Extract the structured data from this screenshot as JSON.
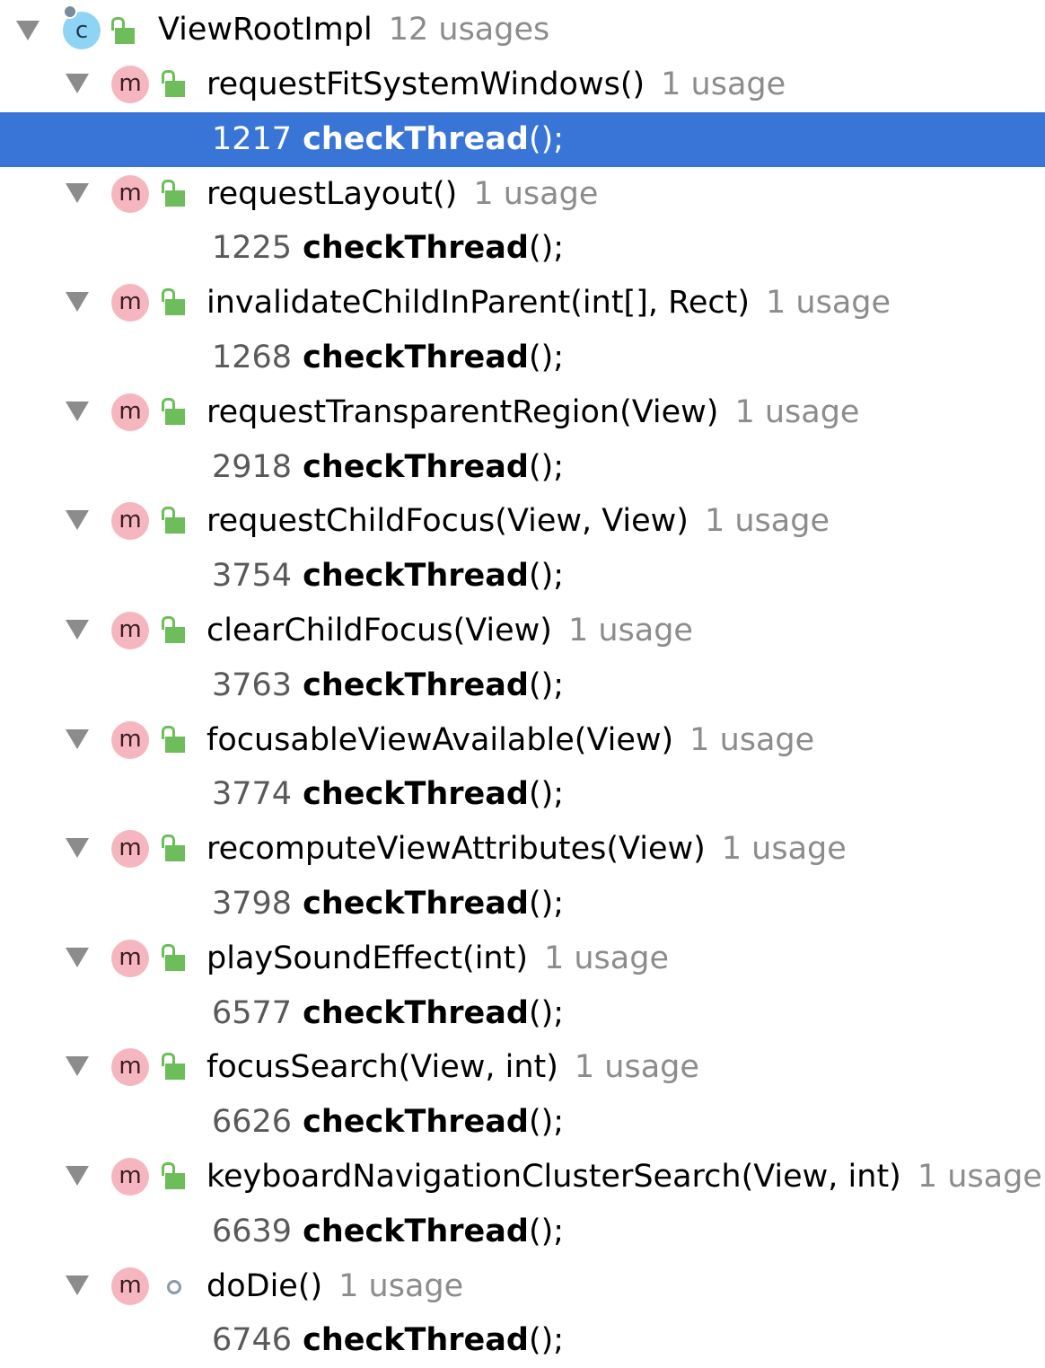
{
  "root": {
    "name": "ViewRootImpl",
    "usages": "12 usages",
    "icon": "class-icon",
    "icon_letter": "c"
  },
  "icons": {
    "method_letter": "m"
  },
  "methods": [
    {
      "name": "requestFitSystemWindows()",
      "usages": "1 usage",
      "access": "public-lock-icon",
      "usage_line": {
        "line_number": "1217",
        "call": "checkThread",
        "suffix": "();",
        "selected": true
      }
    },
    {
      "name": "requestLayout()",
      "usages": "1 usage",
      "access": "public-lock-icon",
      "usage_line": {
        "line_number": "1225",
        "call": "checkThread",
        "suffix": "();",
        "selected": false
      }
    },
    {
      "name": "invalidateChildInParent(int[], Rect)",
      "usages": "1 usage",
      "access": "public-lock-icon",
      "usage_line": {
        "line_number": "1268",
        "call": "checkThread",
        "suffix": "();",
        "selected": false
      }
    },
    {
      "name": "requestTransparentRegion(View)",
      "usages": "1 usage",
      "access": "public-lock-icon",
      "usage_line": {
        "line_number": "2918",
        "call": "checkThread",
        "suffix": "();",
        "selected": false
      }
    },
    {
      "name": "requestChildFocus(View, View)",
      "usages": "1 usage",
      "access": "public-lock-icon",
      "usage_line": {
        "line_number": "3754",
        "call": "checkThread",
        "suffix": "();",
        "selected": false
      }
    },
    {
      "name": "clearChildFocus(View)",
      "usages": "1 usage",
      "access": "public-lock-icon",
      "usage_line": {
        "line_number": "3763",
        "call": "checkThread",
        "suffix": "();",
        "selected": false
      }
    },
    {
      "name": "focusableViewAvailable(View)",
      "usages": "1 usage",
      "access": "public-lock-icon",
      "usage_line": {
        "line_number": "3774",
        "call": "checkThread",
        "suffix": "();",
        "selected": false
      }
    },
    {
      "name": "recomputeViewAttributes(View)",
      "usages": "1 usage",
      "access": "public-lock-icon",
      "usage_line": {
        "line_number": "3798",
        "call": "checkThread",
        "suffix": "();",
        "selected": false
      }
    },
    {
      "name": "playSoundEffect(int)",
      "usages": "1 usage",
      "access": "public-lock-icon",
      "usage_line": {
        "line_number": "6577",
        "call": "checkThread",
        "suffix": "();",
        "selected": false
      }
    },
    {
      "name": "focusSearch(View, int)",
      "usages": "1 usage",
      "access": "public-lock-icon",
      "usage_line": {
        "line_number": "6626",
        "call": "checkThread",
        "suffix": "();",
        "selected": false
      }
    },
    {
      "name": "keyboardNavigationClusterSearch(View, int)",
      "usages": "1 usage",
      "access": "public-lock-icon",
      "usage_line": {
        "line_number": "6639",
        "call": "checkThread",
        "suffix": "();",
        "selected": false
      }
    },
    {
      "name": "doDie()",
      "usages": "1 usage",
      "access": "package-private-icon",
      "usage_line": {
        "line_number": "6746",
        "call": "checkThread",
        "suffix": "();",
        "selected": false
      }
    }
  ],
  "colors": {
    "selection": "#3875d7",
    "usage_gray": "#8c8c8c",
    "method_icon": "#f6b6bf",
    "class_icon": "#8ed4f5",
    "lock_green": "#6dbe5a"
  }
}
